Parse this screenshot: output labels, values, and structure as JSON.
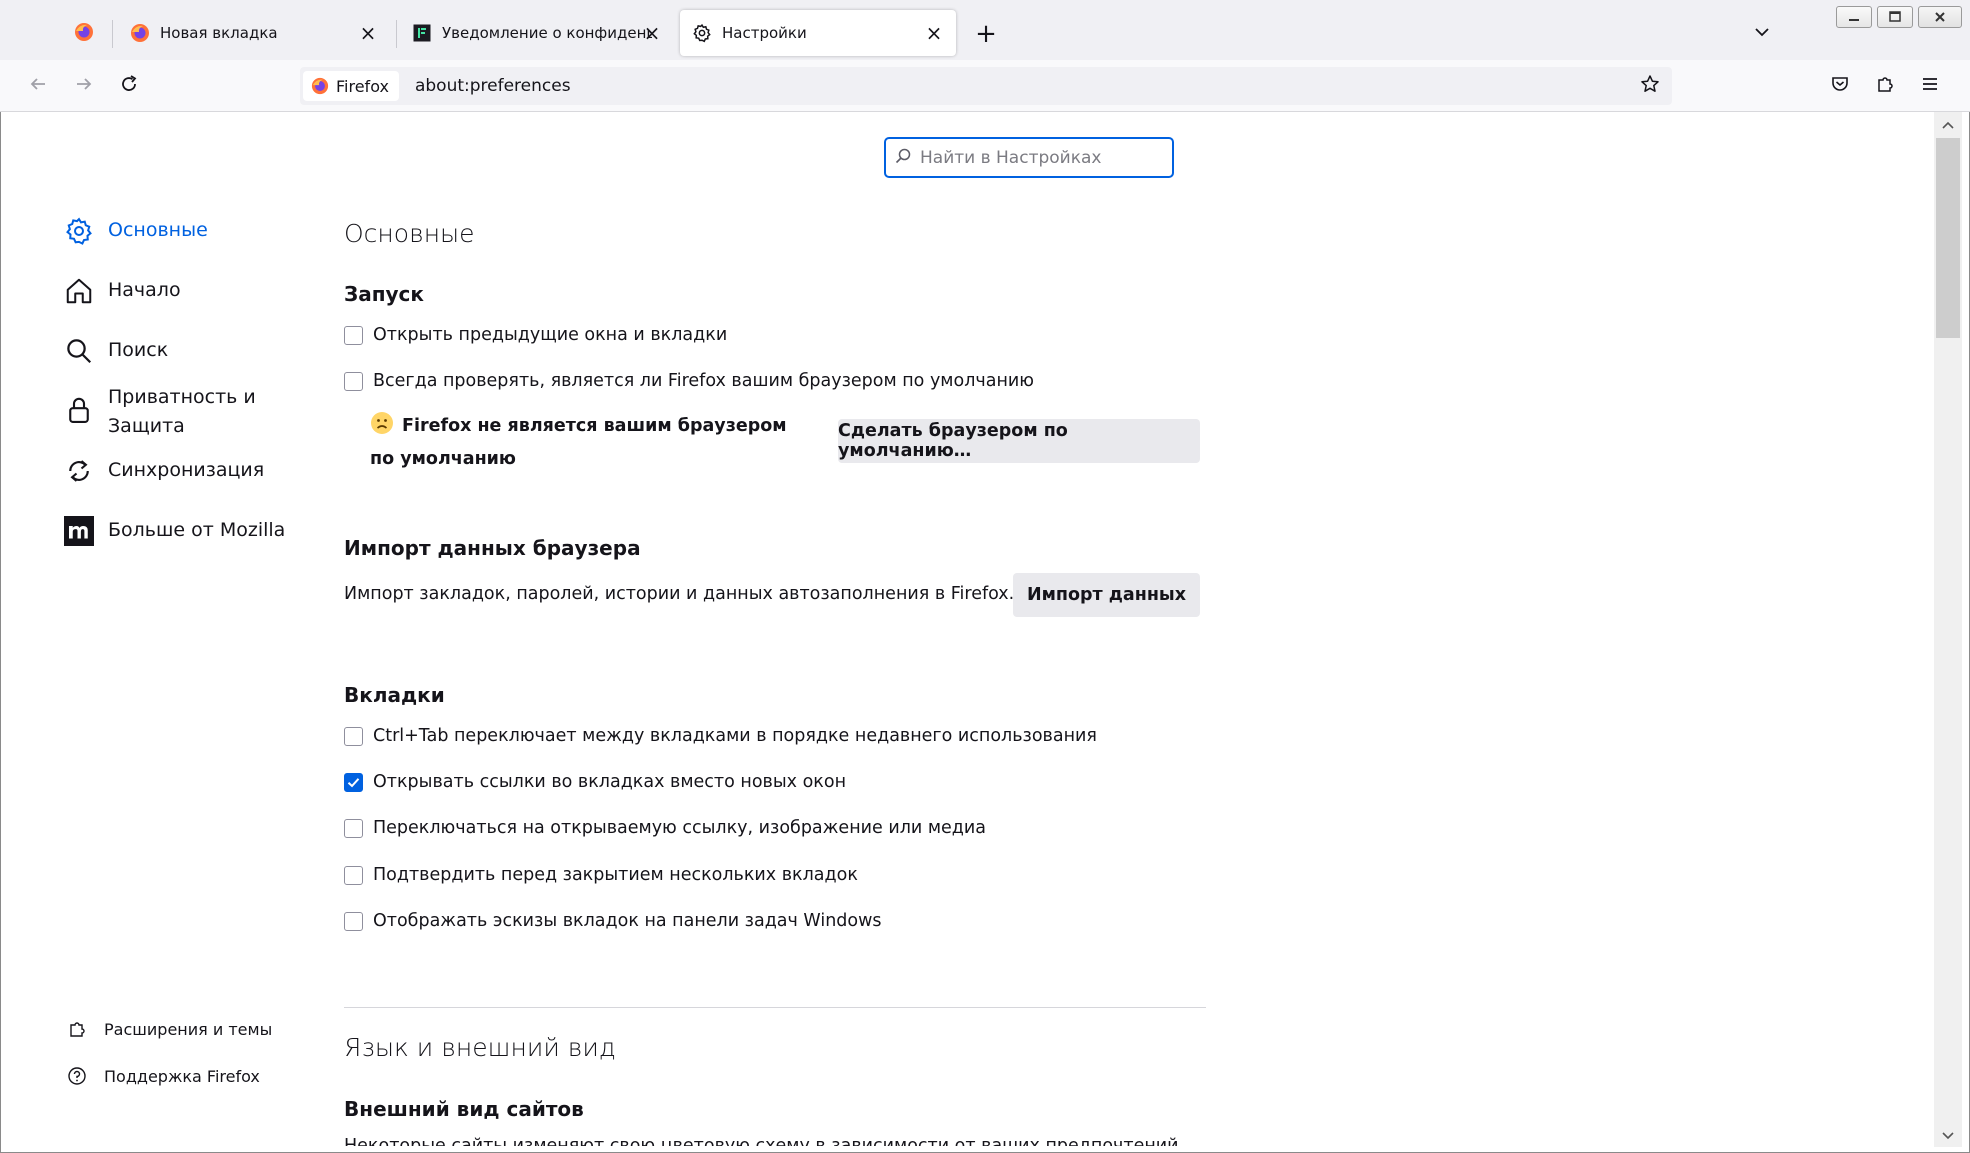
{
  "tabs": [
    {
      "title": "Новая вкладка",
      "active": false
    },
    {
      "title": "Уведомление о конфиденциальности",
      "active": false
    },
    {
      "title": "Настройки",
      "active": true
    }
  ],
  "navbar": {
    "identity_label": "Firefox",
    "url": "about:preferences"
  },
  "search": {
    "placeholder": "Найти в Настройках"
  },
  "sidebar": {
    "items": [
      {
        "label": "Основные",
        "icon": "gear-icon",
        "active": true
      },
      {
        "label": "Начало",
        "icon": "home-icon"
      },
      {
        "label": "Поиск",
        "icon": "search-icon"
      },
      {
        "label": "Приватность и Защита",
        "icon": "lock-icon"
      },
      {
        "label": "Синхронизация",
        "icon": "sync-icon"
      },
      {
        "label": "Больше от Mozilla",
        "icon": "mozilla-icon"
      }
    ],
    "footer": [
      {
        "label": "Расширения и темы",
        "icon": "puzzle-icon"
      },
      {
        "label": "Поддержка Firefox",
        "icon": "help-icon"
      }
    ]
  },
  "main": {
    "title": "Основные",
    "startup": {
      "heading": "Запуск",
      "restore_session": {
        "label": "Открыть предыдущие окна и вкладки",
        "checked": false
      },
      "check_default": {
        "label": "Всегда проверять, является ли Firefox вашим браузером по умолчанию",
        "checked": false
      },
      "not_default_notice": "Firefox не является вашим браузером по умолчанию",
      "make_default_button": "Сделать браузером по умолчанию…"
    },
    "import": {
      "heading": "Импорт данных браузера",
      "description": "Импорт закладок, паролей, истории и данных автозаполнения в Firefox.",
      "button": "Импорт данных"
    },
    "tabs_section": {
      "heading": "Вкладки",
      "options": [
        {
          "label": "Ctrl+Tab переключает между вкладками в порядке недавнего использования",
          "checked": false
        },
        {
          "label": "Открывать ссылки во вкладках вместо новых окон",
          "checked": true
        },
        {
          "label": "Переключаться на открываемую ссылку, изображение или медиа",
          "checked": false
        },
        {
          "label": "Подтвердить перед закрытием нескольких вкладок",
          "checked": false
        },
        {
          "label": "Отображать эскизы вкладок на панели задач Windows",
          "checked": false
        }
      ]
    },
    "language": {
      "title": "Язык и внешний вид",
      "appearance_heading": "Внешний вид сайтов",
      "appearance_desc": "Некоторые сайты изменяют свою цветовую схему в зависимости от ваших предпочтений."
    }
  },
  "colors": {
    "accent": "#0061e0",
    "tab_strip": "#f0f0f4",
    "button": "#e9e9ed"
  }
}
